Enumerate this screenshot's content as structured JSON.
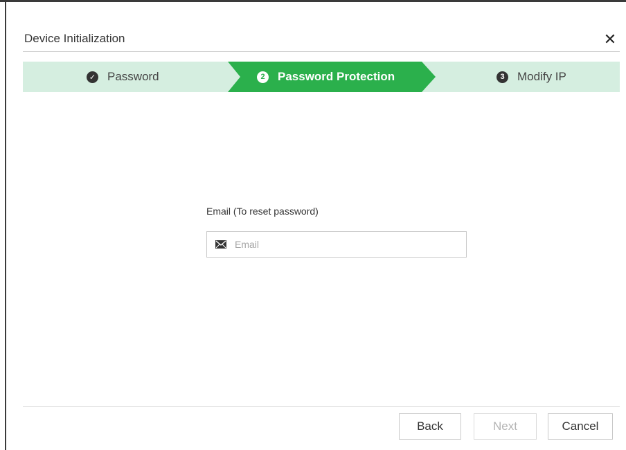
{
  "dialog": {
    "title": "Device Initialization",
    "close_symbol": "✕"
  },
  "steps": [
    {
      "icon": "check-circle-icon",
      "icon_glyph": "✓",
      "label": "Password",
      "state": "done"
    },
    {
      "icon": "number-2-icon",
      "icon_glyph": "2",
      "label": "Password Protection",
      "state": "active"
    },
    {
      "icon": "number-3-icon",
      "icon_glyph": "3",
      "label": "Modify IP",
      "state": "pending"
    }
  ],
  "form": {
    "email_label": "Email (To reset password)",
    "email_value": "",
    "email_placeholder": "Email"
  },
  "buttons": {
    "back": "Back",
    "next": "Next",
    "cancel": "Cancel"
  },
  "colors": {
    "accent": "#2bb04c",
    "step_bar": "#d5eee0"
  }
}
